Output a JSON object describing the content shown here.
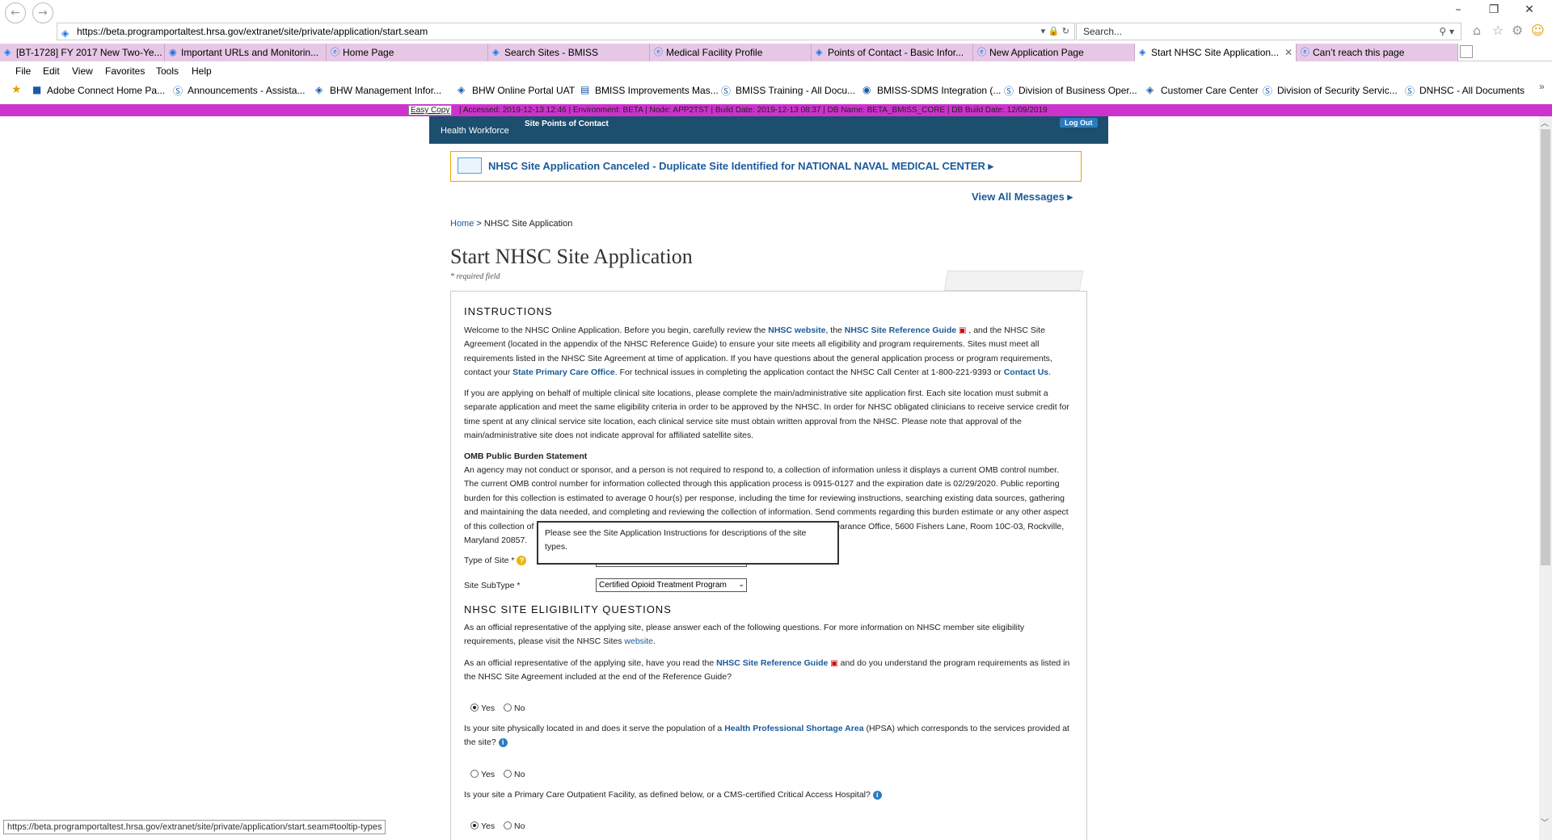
{
  "browser": {
    "url": "https://beta.programportaltest.hrsa.gov/extranet/site/private/application/start.seam",
    "search_placeholder": "Search...",
    "tabs": [
      {
        "label": "[BT-1728] FY 2017 New Two-Ye..."
      },
      {
        "label": "Important URLs and Monitorin..."
      },
      {
        "label": "Home Page"
      },
      {
        "label": "Search Sites - BMISS"
      },
      {
        "label": "Medical Facility Profile"
      },
      {
        "label": "Points of Contact - Basic Infor..."
      },
      {
        "label": "New Application Page"
      },
      {
        "label": "Start NHSC Site Application..."
      },
      {
        "label": "Can’t reach this page"
      }
    ],
    "menu": [
      "File",
      "Edit",
      "View",
      "Favorites",
      "Tools",
      "Help"
    ],
    "favorites": [
      "Adobe Connect Home Pa...",
      "Announcements - Assista...",
      "BHW Management Infor...",
      "BHW Online Portal UAT",
      "BMISS Improvements Mas...",
      "BMISS Training - All Docu...",
      "BMISS-SDMS Integration (...",
      "Division of Business Oper...",
      "Customer Care Center",
      "Division of Security Servic...",
      "DNHSC - All Documents"
    ],
    "status_url": "https://beta.programportaltest.hrsa.gov/extranet/site/private/application/start.seam#tooltip-types"
  },
  "envbar": {
    "easy_copy": "Easy Copy",
    "text": "|    Accessed: 2019-12-13 12:46    |    Environment: BETA    |    Node: APP2TST    |    Build Date: 2019-12-13 08:37    |    DB Name: BETA_BMISS_CORE    |    DB Build Date: 12/09/2019"
  },
  "header": {
    "logo_text": "Health Workforce",
    "section": "Site Points of Contact",
    "logout": "Log Out"
  },
  "message": {
    "text": "NHSC Site Application Canceled - Duplicate Site Identified for NATIONAL NAVAL MEDICAL CENTER  ▸",
    "view_all": "View All Messages  ▸"
  },
  "breadcrumb": {
    "home": "Home",
    "sep": " > ",
    "current": "NHSC Site Application"
  },
  "page": {
    "title": "Start NHSC Site Application",
    "required_note": "* required field"
  },
  "instructions": {
    "heading": "INSTRUCTIONS",
    "p1_a": "Welcome to the NHSC Online Application. Before you begin, carefully review the ",
    "p1_link1": "NHSC website",
    "p1_b": ", the ",
    "p1_link2": "NHSC Site Reference Guide",
    "p1_c": " , and the NHSC Site Agreement (located in the appendix of the NHSC Reference Guide) to ensure your site meets all eligibility and program requirements. Sites must meet all requirements listed in the NHSC Site Agreement at time of application. If you have questions about the general application process or program requirements, contact your ",
    "p1_link3": "State Primary Care Office",
    "p1_d": ". For technical issues in completing the application contact the NHSC Call Center at 1-800-221-9393 or ",
    "p1_link4": "Contact Us",
    "p1_e": ".",
    "p2": "If you are applying on behalf of multiple clinical site locations, please complete the main/administrative site application first. Each site location must submit a separate application and meet the same eligibility criteria in order to be approved by the NHSC. In order for NHSC obligated clinicians to receive service credit for time spent at any clinical service site location, each clinical service site must obtain written approval from the NHSC. Please note that approval of the main/administrative site does not indicate approval for affiliated satellite sites.",
    "omb_heading": "OMB Public Burden Statement",
    "omb_text": "An agency may not conduct or sponsor, and a person is not required to respond to, a collection of information unless it displays a current OMB control number. The current OMB control number for information collected through this application process is 0915-0127 and the expiration date is 02/29/2020. Public reporting burden for this collection is estimated to average 0 hour(s) per response, including the time for reviewing instructions, searching existing data sources, gathering and maintaining the data needed, and completing and reviewing the collection of information. Send comments regarding this burden estimate or any other aspect of this collection of information, including suggestions for reducing this burden, to HRSA Reports Clearance Office, 5600 Fishers Lane, Room 10C-03, Rockville, Maryland 20857."
  },
  "form": {
    "type_label": "Type of Site *",
    "subtype_label": "Site SubType *",
    "subtype_value": "Certified Opioid Treatment Program"
  },
  "tooltip": {
    "text": "Please see the Site Application Instructions for descriptions of the site types."
  },
  "eligibility": {
    "heading": "NHSC SITE ELIGIBILITY QUESTIONS",
    "intro_a": "As an official representative of the applying site, please answer each of the following questions. For more information on NHSC member site eligibility requirements, please visit the NHSC Sites ",
    "intro_link": "website",
    "intro_b": ".",
    "q1_a": "As an official representative of the applying site, have you read the ",
    "q1_link": "NHSC Site Reference Guide",
    "q1_b": "  and do you understand the program requirements as listed in the NHSC Site Agreement included at the end of the Reference Guide?",
    "q2_a": "Is your site physically located in and does it serve the population of a ",
    "q2_link": "Health Professional Shortage Area",
    "q2_b": " (HPSA) which corresponds to the services provided at the site?",
    "q3": "Is your site a Primary Care Outpatient Facility, as defined below, or a CMS-certified Critical Access Hospital?",
    "yes": "Yes",
    "no": "No"
  }
}
